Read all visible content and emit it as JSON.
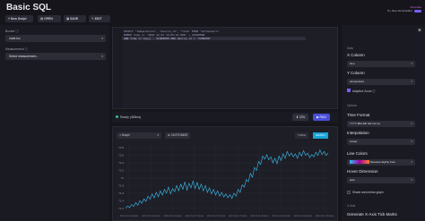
{
  "page": {
    "title": "Basic SQL"
  },
  "toolbar": {
    "new_script": "+ New Script",
    "open": "OPEN",
    "save": "SAVE",
    "edit": "EDIT"
  },
  "header_right": {
    "toggle_label": "Try New Script Editor",
    "brand": "influxdata"
  },
  "sidebar": {
    "bucket_label": "Bucket",
    "bucket_value": "node-loc",
    "measurement_label": "Measurement",
    "measurement_placeholder": "Select measurement..."
  },
  "editor": {
    "lines": [
      "SELECT \"temperature\", \"device_id\", \"time\" FROM \"airSensors\"",
      "WHERE time >= '2022-12-01 15:05:43.000' + 21600000",
      "AND time <= now() - 21600000 AND device_id = 'TLM0200'"
    ],
    "highlight_line": 3
  },
  "runbar": {
    "status": "Ready (483ms)",
    "csv_label": "CSV",
    "run_label": "RUN"
  },
  "viz": {
    "type_label": "Graph",
    "customize_label": "CUSTOMIZE",
    "table_tab": "TABLE",
    "graph_tab": "GRAPH"
  },
  "options": {
    "header": "Data",
    "x_column_label": "X Column",
    "x_column_value": "time",
    "y_column_label": "Y Column",
    "y_column_value": "temperature",
    "adaptive_zoom_label": "Adaptive Zoom",
    "options_header": "Options",
    "time_format_label": "Time Format",
    "time_format_value": "YYYY-MM-DD HH:mm:ss",
    "interpolation_label": "Interpolation",
    "interpolation_value": "Linear",
    "line_colors_label": "Line Colors",
    "line_colors_value": "Nineteen Eighty Four",
    "hover_dimension_label": "Hover Dimension",
    "hover_dimension_value": "auto",
    "shade_label": "Shade area below graph",
    "x_axis_header": "X-Axis",
    "x_axis_ticks_label": "Generate X-Axis Tick Marks"
  },
  "colors": {
    "line": "#3bc1f0",
    "run_button": "#4a4fd8",
    "accent_toggle": "#7c5cff",
    "active_tab": "#18a5d6"
  },
  "chart_data": {
    "type": "line",
    "title": "",
    "xlabel": "",
    "ylabel": "",
    "y_ticks": [
      "72.8",
      "72.6",
      "72.4",
      "72.2",
      "72",
      "71.8",
      "71.6",
      "71.4",
      "71.2"
    ],
    "x_ticks": [
      "2022-12-01 16:00:00",
      "2022-12-01 16:20:00",
      "2022-12-01 16:40:00",
      "2022-12-01 17:00:00",
      "2022-12-01 17:20:00",
      "2022-12-01 17:40:00",
      "2022-12-01 18:00:00",
      "2022-12-01 18:20:00",
      "2022-12-01 18:40:00",
      "2022-12-01 19:00:00"
    ],
    "ylim": [
      71.1,
      72.85
    ],
    "series": [
      {
        "values": [
          71.2,
          71.26,
          71.22,
          71.3,
          71.25,
          71.35,
          71.28,
          71.4,
          71.33,
          71.45,
          71.38,
          71.52,
          71.44,
          71.58,
          71.47,
          71.62,
          71.5,
          71.66,
          71.55,
          71.7,
          71.6,
          71.76,
          71.58,
          71.72,
          71.64,
          71.8,
          71.66,
          71.84,
          71.7,
          71.9,
          71.68,
          71.86,
          71.74,
          71.92,
          71.72,
          71.88,
          71.7,
          71.84,
          71.66,
          71.8,
          71.62,
          71.74,
          71.58,
          71.7,
          71.55,
          71.66,
          71.52,
          71.62,
          71.5,
          71.58,
          71.48,
          71.56,
          71.46,
          71.6,
          71.52,
          71.7,
          71.62,
          71.82,
          71.76,
          71.96,
          71.9,
          72.12,
          72.02,
          72.28,
          72.2,
          72.44,
          72.36,
          72.58,
          72.5,
          72.62,
          72.48,
          72.56,
          72.4,
          72.52,
          72.38,
          72.58,
          72.46,
          72.64,
          72.52,
          72.7,
          72.58,
          72.66,
          72.56,
          72.64,
          72.52,
          72.68,
          72.58,
          72.72,
          72.6,
          72.66,
          72.54,
          72.62,
          72.56,
          72.68,
          72.6,
          72.74,
          72.62,
          72.7,
          72.6,
          72.66
        ]
      }
    ],
    "grid": true,
    "legend": "none"
  }
}
